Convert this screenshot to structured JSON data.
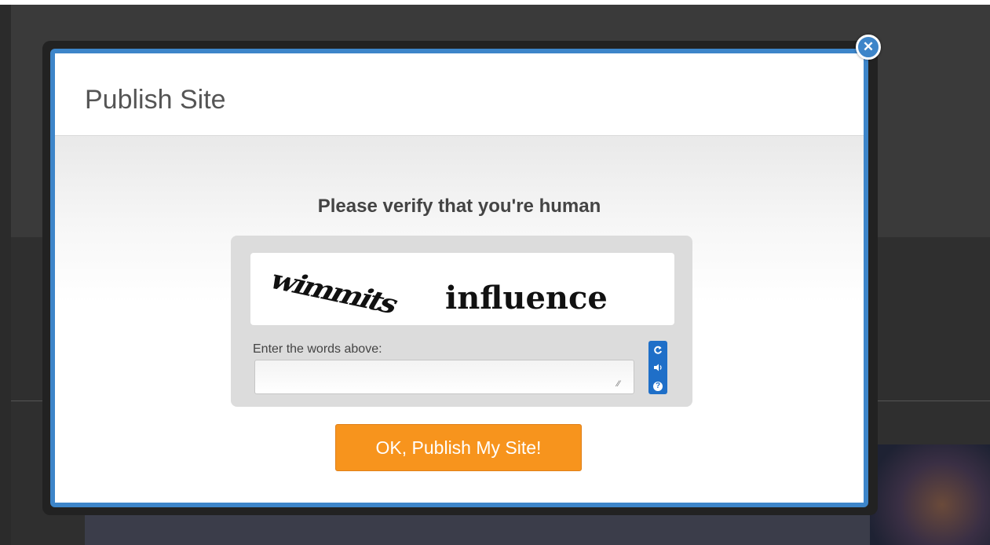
{
  "modal": {
    "title": "Publish Site",
    "close_icon": "close-icon"
  },
  "captcha": {
    "heading": "Please verify that you're human",
    "word_1": "wimmits",
    "word_2": "influence",
    "input_label": "Enter the words above:",
    "input_value": "",
    "controls": {
      "refresh_icon": "refresh-icon",
      "audio_icon": "audio-icon",
      "help_icon": "help-icon"
    }
  },
  "actions": {
    "publish_label": "OK, Publish My Site!"
  },
  "colors": {
    "modal_border": "#3d85c9",
    "publish_button": "#f7941d",
    "captcha_controls": "#1f6fc8"
  }
}
